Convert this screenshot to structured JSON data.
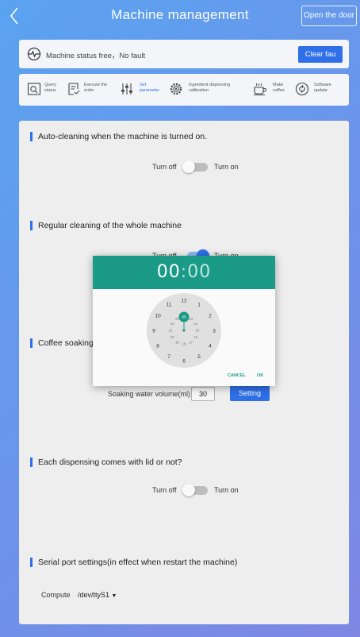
{
  "header": {
    "title": "Machine management",
    "door_button": "Open the door"
  },
  "status": {
    "text": "Machine status  free，No fault",
    "clear_button": "Clear fau"
  },
  "nav": {
    "items": [
      {
        "label": "Query status",
        "icon": "search-icon"
      },
      {
        "label": "Execute the order",
        "icon": "order-icon"
      },
      {
        "label": "Set parameter",
        "icon": "sliders-icon",
        "active": true
      },
      {
        "label": "Ingredient dispensing calibration",
        "icon": "gear-icon"
      },
      {
        "label": "Make coffee",
        "icon": "coffee-cup-icon"
      },
      {
        "label": "Software update",
        "icon": "update-icon"
      }
    ]
  },
  "sections": {
    "auto_clean": {
      "title": "Auto-cleaning when the machine is turned on.",
      "off": "Turn off",
      "on": "Turn on",
      "state": "off"
    },
    "regular_clean": {
      "title": "Regular cleaning of the whole machine",
      "off": "Turn off",
      "on": "Turn on",
      "state": "on"
    },
    "coffee_soak": {
      "title": "Coffee soaking",
      "volume_label": "Soaking water volume(ml)",
      "volume_value": "30",
      "setting_button": "Setting"
    },
    "lid": {
      "title": "Each dispensing comes with lid or not?",
      "off": "Turn off",
      "on": "Turn on",
      "state": "off"
    },
    "serial": {
      "title": "Serial port settings(in effect when restart the machine)",
      "label": "Compute",
      "value": "/dev/ttyS1"
    }
  },
  "time_picker": {
    "hour": "00",
    "separator": ":",
    "minute": "00",
    "outer_hours": [
      "12",
      "1",
      "2",
      "3",
      "4",
      "5",
      "6",
      "7",
      "8",
      "9",
      "10",
      "11"
    ],
    "inner_hours": [
      "00",
      "13",
      "14",
      "15",
      "16",
      "17",
      "18",
      "19",
      "20",
      "21",
      "22",
      "23"
    ],
    "selected": "00",
    "cancel": "CANCEL",
    "ok": "OK",
    "accent": "#1a9a87"
  },
  "colors": {
    "primary": "#2f6fe8",
    "teal": "#1a9a87"
  }
}
